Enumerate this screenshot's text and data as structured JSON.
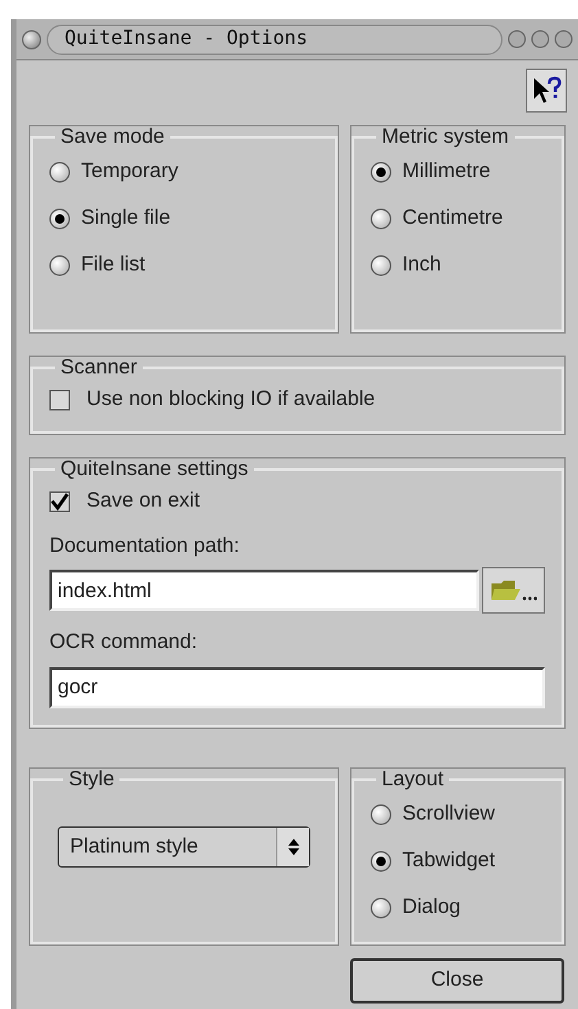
{
  "window": {
    "title": "QuiteInsane - Options"
  },
  "save_mode": {
    "title": "Save mode",
    "options": [
      {
        "label": "Temporary",
        "selected": false
      },
      {
        "label": "Single file",
        "selected": true
      },
      {
        "label": "File list",
        "selected": false
      }
    ]
  },
  "metric_system": {
    "title": "Metric system",
    "options": [
      {
        "label": "Millimetre",
        "selected": true
      },
      {
        "label": "Centimetre",
        "selected": false
      },
      {
        "label": "Inch",
        "selected": false
      }
    ]
  },
  "scanner": {
    "title": "Scanner",
    "checkbox": {
      "label": "Use non blocking IO if available",
      "checked": false
    }
  },
  "settings": {
    "title": "QuiteInsane settings",
    "checkbox": {
      "label": "Save on exit",
      "checked": true
    },
    "doc_path": {
      "label": "Documentation path:",
      "value": "index.html"
    },
    "ocr": {
      "label": "OCR command:",
      "value": "gocr"
    }
  },
  "style": {
    "title": "Style",
    "value": "Platinum style"
  },
  "layout": {
    "title": "Layout",
    "options": [
      {
        "label": "Scrollview",
        "selected": false
      },
      {
        "label": "Tabwidget",
        "selected": true
      },
      {
        "label": "Dialog",
        "selected": false
      }
    ]
  },
  "buttons": [
    {
      "label": "Close"
    }
  ]
}
